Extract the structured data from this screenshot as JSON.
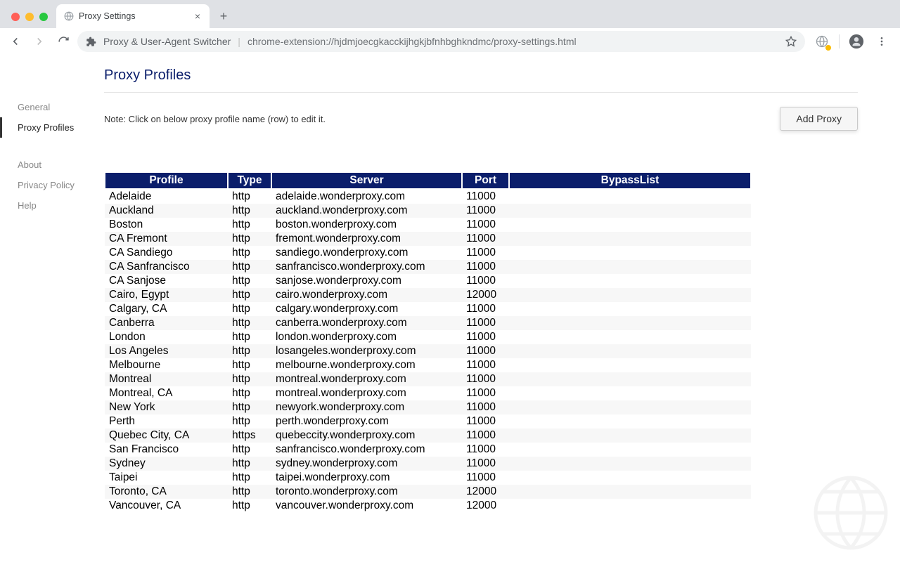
{
  "browser": {
    "tab_title": "Proxy Settings",
    "ext_name": "Proxy & User-Agent Switcher",
    "url": "chrome-extension://hjdmjoecgkacckijhgkjbfnhbghkndmc/proxy-settings.html"
  },
  "sidebar": {
    "items": [
      {
        "label": "General",
        "active": false
      },
      {
        "label": "Proxy Profiles",
        "active": true
      }
    ],
    "secondary": [
      {
        "label": "About"
      },
      {
        "label": "Privacy Policy"
      },
      {
        "label": "Help"
      }
    ]
  },
  "header": {
    "title": "Proxy Profiles",
    "note": "Note: Click on below proxy profile name (row) to edit it.",
    "add_button": "Add Proxy"
  },
  "table": {
    "columns": [
      "Profile",
      "Type",
      "Server",
      "Port",
      "BypassList"
    ],
    "rows": [
      {
        "profile": "Adelaide",
        "type": "http",
        "server": "adelaide.wonderproxy.com",
        "port": "11000",
        "bypass": ""
      },
      {
        "profile": "Auckland",
        "type": "http",
        "server": "auckland.wonderproxy.com",
        "port": "11000",
        "bypass": ""
      },
      {
        "profile": "Boston",
        "type": "http",
        "server": "boston.wonderproxy.com",
        "port": "11000",
        "bypass": ""
      },
      {
        "profile": "CA Fremont",
        "type": "http",
        "server": "fremont.wonderproxy.com",
        "port": "11000",
        "bypass": ""
      },
      {
        "profile": "CA Sandiego",
        "type": "http",
        "server": "sandiego.wonderproxy.com",
        "port": "11000",
        "bypass": ""
      },
      {
        "profile": "CA Sanfrancisco",
        "type": "http",
        "server": "sanfrancisco.wonderproxy.com",
        "port": "11000",
        "bypass": ""
      },
      {
        "profile": "CA Sanjose",
        "type": "http",
        "server": "sanjose.wonderproxy.com",
        "port": "11000",
        "bypass": ""
      },
      {
        "profile": "Cairo, Egypt",
        "type": "http",
        "server": "cairo.wonderproxy.com",
        "port": "12000",
        "bypass": ""
      },
      {
        "profile": "Calgary, CA",
        "type": "http",
        "server": "calgary.wonderproxy.com",
        "port": "11000",
        "bypass": ""
      },
      {
        "profile": "Canberra",
        "type": "http",
        "server": "canberra.wonderproxy.com",
        "port": "11000",
        "bypass": ""
      },
      {
        "profile": "London",
        "type": "http",
        "server": "london.wonderproxy.com",
        "port": "11000",
        "bypass": ""
      },
      {
        "profile": "Los Angeles",
        "type": "http",
        "server": "losangeles.wonderproxy.com",
        "port": "11000",
        "bypass": ""
      },
      {
        "profile": "Melbourne",
        "type": "http",
        "server": "melbourne.wonderproxy.com",
        "port": "11000",
        "bypass": ""
      },
      {
        "profile": "Montreal",
        "type": "http",
        "server": "montreal.wonderproxy.com",
        "port": "11000",
        "bypass": ""
      },
      {
        "profile": "Montreal, CA",
        "type": "http",
        "server": "montreal.wonderproxy.com",
        "port": "11000",
        "bypass": ""
      },
      {
        "profile": "New York",
        "type": "http",
        "server": "newyork.wonderproxy.com",
        "port": "11000",
        "bypass": ""
      },
      {
        "profile": "Perth",
        "type": "http",
        "server": "perth.wonderproxy.com",
        "port": "11000",
        "bypass": ""
      },
      {
        "profile": "Quebec City, CA",
        "type": "https",
        "server": "quebeccity.wonderproxy.com",
        "port": "11000",
        "bypass": ""
      },
      {
        "profile": "San Francisco",
        "type": "http",
        "server": "sanfrancisco.wonderproxy.com",
        "port": "11000",
        "bypass": ""
      },
      {
        "profile": "Sydney",
        "type": "http",
        "server": "sydney.wonderproxy.com",
        "port": "11000",
        "bypass": ""
      },
      {
        "profile": "Taipei",
        "type": "http",
        "server": "taipei.wonderproxy.com",
        "port": "11000",
        "bypass": ""
      },
      {
        "profile": "Toronto, CA",
        "type": "http",
        "server": "toronto.wonderproxy.com",
        "port": "12000",
        "bypass": ""
      },
      {
        "profile": "Vancouver, CA",
        "type": "http",
        "server": "vancouver.wonderproxy.com",
        "port": "12000",
        "bypass": ""
      }
    ]
  }
}
